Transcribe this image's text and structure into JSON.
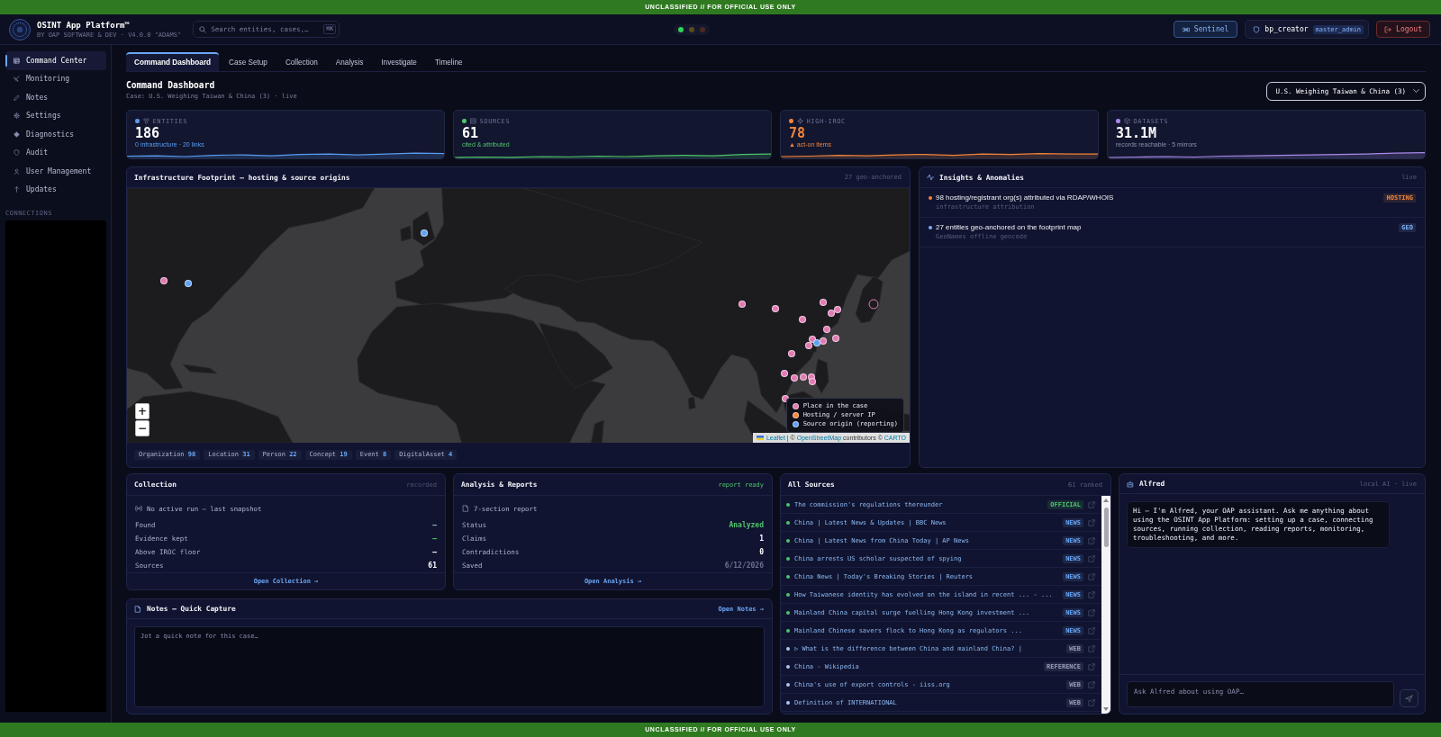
{
  "banner_top": "UNCLASSIFIED // FOR OFFICIAL USE ONLY",
  "header": {
    "title": "OSINT App Platform™",
    "subtitle": "BY OAP SOFTWARE & DEV · V4.0.0 \"ADAMS\"",
    "search": {
      "placeholder": "Search entities, cases,…",
      "shortcut": "⌘K"
    },
    "status_lights": [
      {
        "color": "#2fd35a"
      },
      {
        "color": "#5c4a1c"
      },
      {
        "color": "#4a2a22"
      }
    ],
    "sentinel_button": "Sentinel",
    "user": {
      "name": "bp_creator",
      "role": "master_admin"
    },
    "logout_button": "Logout"
  },
  "sidebar": {
    "items": [
      {
        "label": "Command Center",
        "selected": true
      },
      {
        "label": "Monitoring",
        "selected": false
      },
      {
        "label": "Notes",
        "selected": false
      },
      {
        "label": "Settings",
        "selected": false
      },
      {
        "label": "Diagnostics",
        "selected": false
      },
      {
        "label": "Audit",
        "selected": false
      },
      {
        "label": "User Management",
        "selected": false
      },
      {
        "label": "Updates",
        "selected": false
      }
    ],
    "section_label": "CONNECTIONS"
  },
  "tabs": [
    {
      "label": "Command Dashboard",
      "selected": true
    },
    {
      "label": "Case Setup",
      "selected": false
    },
    {
      "label": "Collection",
      "selected": false
    },
    {
      "label": "Analysis",
      "selected": false
    },
    {
      "label": "Investigate",
      "selected": false
    },
    {
      "label": "Timeline",
      "selected": false
    }
  ],
  "page": {
    "title": "Command Dashboard",
    "subtitle": "Case: U.S. Weighing Taiwan & China (3) · live",
    "case_selector": {
      "value": "U.S. Weighing Taiwan & China (3)"
    }
  },
  "stats": [
    {
      "label": "ENTITIES",
      "value": "186",
      "note": "0 infrastructure · 20 links",
      "color": "#5b9cf0",
      "alert": false,
      "note_muted": false
    },
    {
      "label": "SOURCES",
      "value": "61",
      "note": "cited & attributed",
      "color": "#4fc36b",
      "alert": false,
      "note_muted": false
    },
    {
      "label": "HIGH-IROC",
      "value": "78",
      "note": "▲ act-on items",
      "color": "#f0843c",
      "alert": true,
      "note_muted": false
    },
    {
      "label": "DATASETS",
      "value": "31.1M",
      "note": "records reachable · 5 mirrors",
      "color": "#a88ae8",
      "alert": false,
      "note_muted": true
    }
  ],
  "footprint": {
    "title": "Infrastructure Footprint — hosting & source origins",
    "count": "27 geo-anchored",
    "zoom_controls": [
      "+",
      "−"
    ],
    "legend": [
      {
        "label": "Place in the case",
        "color": "#e27bb4"
      },
      {
        "label": "Hosting / server IP",
        "color": "#f0883e"
      },
      {
        "label": "Source origin (reporting)",
        "color": "#5fa2f2"
      }
    ],
    "attribution": [
      {
        "text": "Leaflet",
        "link": true
      },
      {
        "text": "| ©",
        "link": false
      },
      {
        "text": "OpenStreetMap",
        "link": true
      },
      {
        "text": "contributors ©",
        "link": false
      },
      {
        "text": "CARTO",
        "link": true
      }
    ],
    "entity_counts": [
      {
        "label": "Organization",
        "count": "98"
      },
      {
        "label": "Location",
        "count": "31"
      },
      {
        "label": "Person",
        "count": "22"
      },
      {
        "label": "Concept",
        "count": "19"
      },
      {
        "label": "Event",
        "count": "8"
      },
      {
        "label": "DigitalAsset",
        "count": "4"
      }
    ]
  },
  "insights": {
    "title": "Insights & Anomalies",
    "status": "live",
    "items": [
      {
        "text": "98 hosting/registrant org(s) attributed via RDAP/WHOIS",
        "detail": "infrastructure attribution",
        "tag": "HOSTING",
        "color": "#f0843c"
      },
      {
        "text": "27 entities geo-anchored on the footprint map",
        "detail": "GeoNames offline geocode",
        "tag": "GEO",
        "color": "#7fb0f5"
      }
    ]
  },
  "collection": {
    "title": "Collection",
    "status": {
      "text": "recorded",
      "kind": "quiet"
    },
    "summary": "No active run — last snapshot",
    "rows": [
      {
        "label": "Found",
        "value": "—",
        "kind": "muted"
      },
      {
        "label": "Evidence kept",
        "value": "—",
        "kind": "positive"
      },
      {
        "label": "Above IROC floor",
        "value": "—",
        "kind": "plain"
      },
      {
        "label": "Sources",
        "value": "61",
        "kind": "plain"
      }
    ],
    "link": "Open Collection →"
  },
  "analysis": {
    "title": "Analysis & Reports",
    "status": {
      "text": "report ready",
      "kind": "positive"
    },
    "summary": "7-section report",
    "rows": [
      {
        "label": "Status",
        "value": "Analyzed",
        "kind": "positive"
      },
      {
        "label": "Claims",
        "value": "1",
        "kind": "plain"
      },
      {
        "label": "Contradictions",
        "value": "0",
        "kind": "plain"
      },
      {
        "label": "Saved",
        "value": "6/12/2026",
        "kind": "dim"
      }
    ],
    "link": "Open Analysis →"
  },
  "notes": {
    "title": "Notes — Quick Capture",
    "link": "Open Notes →",
    "placeholder": "Jot a quick note for this case…"
  },
  "sources": {
    "title": "All Sources",
    "count": "61 ranked",
    "items": [
      {
        "title": "The commission's regulations thereunder",
        "color": "#4fc36b",
        "tag": {
          "text": "OFFICIAL",
          "kind": "official"
        }
      },
      {
        "title": "China | Latest News & Updates | BBC News",
        "color": "#4fc36b",
        "tag": {
          "text": "NEWS",
          "kind": "news"
        }
      },
      {
        "title": "China | Latest News from China Today | AP News",
        "color": "#4fc36b",
        "tag": {
          "text": "NEWS",
          "kind": "news"
        }
      },
      {
        "title": "China arrests US scholar suspected of spying",
        "color": "#4fc36b",
        "tag": {
          "text": "NEWS",
          "kind": "news"
        }
      },
      {
        "title": "China News | Today's Breaking Stories | Reuters",
        "color": "#4fc36b",
        "tag": {
          "text": "NEWS",
          "kind": "news"
        }
      },
      {
        "title": "How Taiwanese identity has evolved on the island in recent ... - ...",
        "color": "#4fc36b",
        "tag": {
          "text": "NEWS",
          "kind": "news"
        }
      },
      {
        "title": "Mainland China capital surge fuelling Hong Kong investment ...",
        "color": "#4fc36b",
        "tag": {
          "text": "NEWS",
          "kind": "news"
        }
      },
      {
        "title": "Mainland Chinese savers flock to Hong Kong as regulators ...",
        "color": "#4fc36b",
        "tag": {
          "text": "NEWS",
          "kind": "news"
        }
      },
      {
        "title": "▷ What is the difference between China and mainland China? |",
        "color": "#a9c8f2",
        "tag": {
          "text": "WEB",
          "kind": "web"
        }
      },
      {
        "title": "China - Wikipedia",
        "color": "#a9c8f2",
        "tag": {
          "text": "REFERENCE",
          "kind": "reference"
        }
      },
      {
        "title": "China's use of export controls - iiss.org",
        "color": "#a9c8f2",
        "tag": {
          "text": "WEB",
          "kind": "web"
        }
      },
      {
        "title": "Definition of INTERNATIONAL",
        "color": "#a9c8f2",
        "tag": {
          "text": "WEB",
          "kind": "web"
        }
      }
    ]
  },
  "assistant": {
    "name": "Alfred",
    "status": "local AI · live",
    "messages": [
      {
        "text": "Hi — I'm Alfred, your OAP assistant. Ask me anything about using the OSINT App Platform: setting up a case, connecting sources, running collection, reading reports, monitoring, troubleshooting, and more."
      }
    ],
    "input": {
      "placeholder": "Ask Alfred about using OAP…"
    }
  },
  "banner_bottom": "UNCLASSIFIED // FOR OFFICIAL USE ONLY"
}
